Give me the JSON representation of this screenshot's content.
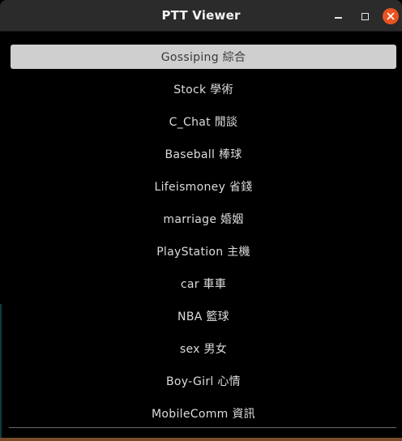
{
  "window": {
    "title": "PTT Viewer"
  },
  "controls": {
    "minimize_icon": "minimize-icon",
    "maximize_icon": "maximize-icon",
    "close_icon": "close-icon",
    "close_color": "#e95420"
  },
  "boards": {
    "selected_index": 0,
    "items": [
      {
        "label": "Gossiping 綜合"
      },
      {
        "label": "Stock 學術"
      },
      {
        "label": "C_Chat 閒談"
      },
      {
        "label": "Baseball 棒球"
      },
      {
        "label": "Lifeismoney 省錢"
      },
      {
        "label": "marriage 婚姻"
      },
      {
        "label": "PlayStation 主機"
      },
      {
        "label": "car 車車"
      },
      {
        "label": "NBA 籃球"
      },
      {
        "label": "sex 男女"
      },
      {
        "label": "Boy-Girl 心情"
      },
      {
        "label": "MobileComm 資訊"
      }
    ]
  },
  "colors": {
    "background": "#000000",
    "selected_background": "#cfcfcf",
    "text": "#dcdcdc"
  }
}
